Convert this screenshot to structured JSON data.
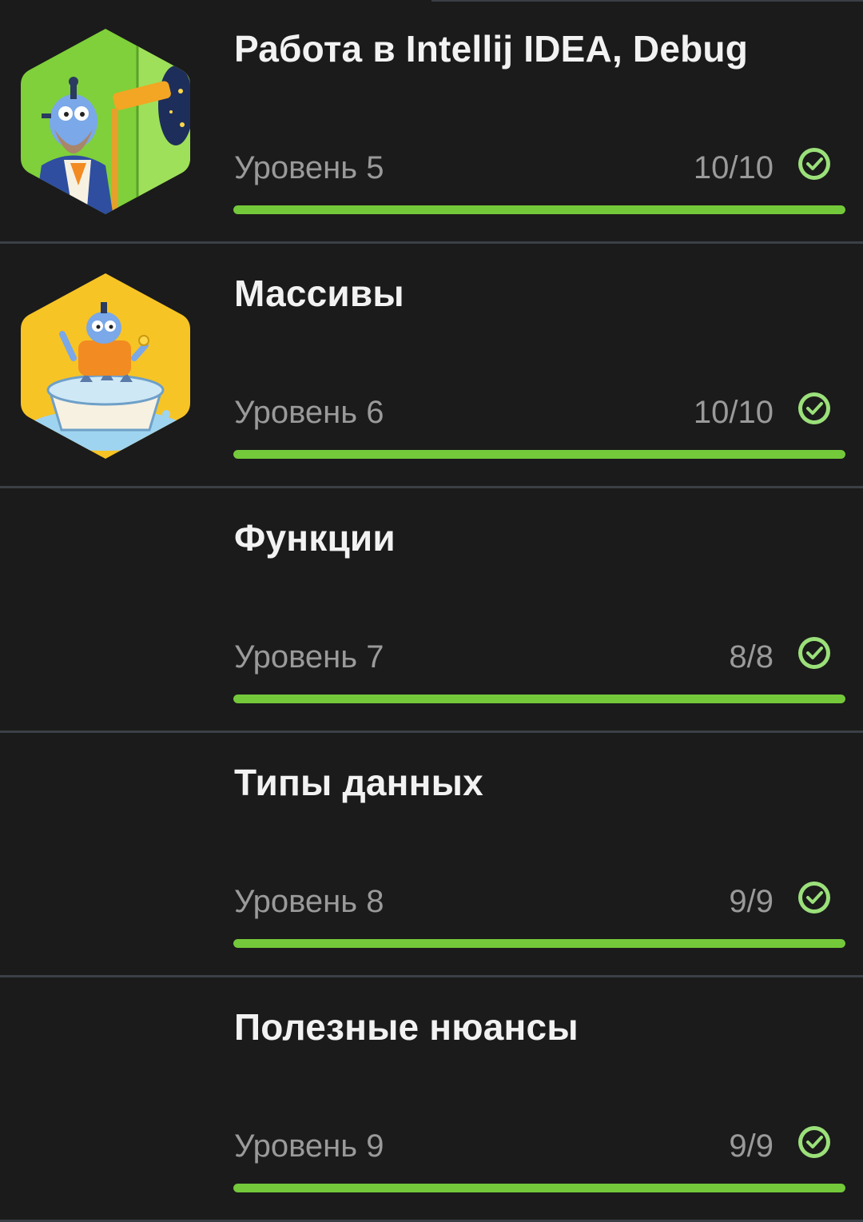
{
  "colors": {
    "background": "#1b1b1b",
    "divider": "#3b4047",
    "progress": "#74c93a",
    "check": "#9be07a",
    "title": "#f2f2f2",
    "muted": "#9a9a9a"
  },
  "levels": [
    {
      "title": "Работа в Intellij IDEA, Debug",
      "level_label": "Уровень 5",
      "count": "10/10",
      "progress": 1.0,
      "completed": true,
      "image": "astronomer-robot-telescope"
    },
    {
      "title": "Массивы",
      "level_label": "Уровень 6",
      "count": "10/10",
      "progress": 1.0,
      "completed": true,
      "image": "robot-in-bathtub"
    },
    {
      "title": "Функции",
      "level_label": "Уровень 7",
      "count": "8/8",
      "progress": 1.0,
      "completed": true,
      "image": ""
    },
    {
      "title": "Типы данных",
      "level_label": "Уровень 8",
      "count": "9/9",
      "progress": 1.0,
      "completed": true,
      "image": ""
    },
    {
      "title": "Полезные нюансы",
      "level_label": "Уровень 9",
      "count": "9/9",
      "progress": 1.0,
      "completed": true,
      "image": ""
    }
  ]
}
